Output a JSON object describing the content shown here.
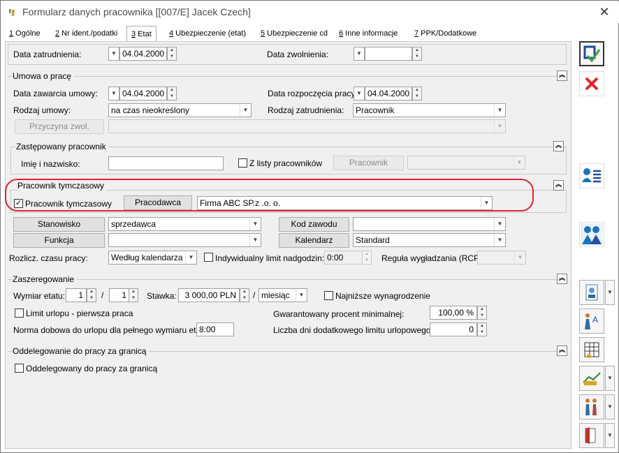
{
  "window": {
    "title": "Formularz danych pracownika [[007/E] Jacek Czech]",
    "close": "✕"
  },
  "tabs": [
    {
      "key": "1",
      "label": " Ogólne"
    },
    {
      "key": "2",
      "label": " Nr ident./podatki"
    },
    {
      "key": "3",
      "label": " Etat"
    },
    {
      "key": "4",
      "label": " Ubezpieczenie (etat)"
    },
    {
      "key": "5",
      "label": " Ubezpieczenie cd"
    },
    {
      "key": "6",
      "label": " Inne informacje"
    },
    {
      "key": "7",
      "label": " PPK/Dodatkowe"
    }
  ],
  "top": {
    "hire_date_label": "Data zatrudnienia:",
    "hire_date": "04.04.2000",
    "release_date_label": "Data zwolnienia:",
    "release_date": ""
  },
  "contract": {
    "title": "Umowa o pracę",
    "sign_date_label": "Data zawarcia umowy:",
    "sign_date": "04.04.2000",
    "start_date_label": "Data rozpoczęcia pracy:",
    "start_date": "04.04.2000",
    "type_label": "Rodzaj umowy:",
    "type": "na czas nieokreślony",
    "employment_label": "Rodzaj zatrudnienia:",
    "employment": "Pracownik",
    "reason_button": "Przyczyna zwol.",
    "reason": ""
  },
  "replaced": {
    "title": "Zastępowany pracownik",
    "name_label": "Imię i nazwisko:",
    "name": "",
    "from_list_label": "Z listy pracowników",
    "employee_button": "Pracownik",
    "employee": ""
  },
  "temp": {
    "title": "Pracownik tymczasowy",
    "checkbox_label": "Pracownik tymczasowy",
    "checked": true,
    "employer_button": "Pracodawca",
    "employer": "Firma ABC SP.z .o. o."
  },
  "position": {
    "position_button": "Stanowisko",
    "position": "sprzedawca",
    "function_button": "Funkcja",
    "function": "",
    "job_code_button": "Kod zawodu",
    "job_code": "",
    "calendar_button": "Kalendarz",
    "calendar": "Standard",
    "worktime_label": "Rozlicz. czasu pracy:",
    "worktime": "Według kalendarza",
    "limit_label": "Indywidualny limit nadgodzin:",
    "limit": "0:00",
    "smoothing_label": "Reguła wygładzania (RCP):",
    "smoothing": ""
  },
  "grade": {
    "title": "Zaszeregowanie",
    "etat_label": "Wymiar etatu:",
    "etat_num": "1",
    "etat_sep": "/",
    "etat_den": "1",
    "rate_label": "Stawka:",
    "rate": "3 000,00 PLN",
    "rate_sep": "/",
    "period": "miesiąc",
    "min_wage_label": "Najniższe wynagrodzenie",
    "leave_limit_label": "Limit urlopu - pierwsza praca",
    "guaranteed_label": "Gwarantowany procent minimalnej:",
    "guaranteed": "100,00 %",
    "norm_label": "Norma dobowa do urlopu dla pełnego wymiaru etatu:",
    "norm": "8:00",
    "extra_days_label": "Liczba dni dodatkowego limitu urlopowego:",
    "extra_days": "0"
  },
  "delegation": {
    "title": "Oddelegowanie do pracy za granicą",
    "checkbox_label": "Oddelegowany do pracy za granicą"
  },
  "colors": {
    "highlight": "#e2242b",
    "accent": "#1e73be"
  }
}
